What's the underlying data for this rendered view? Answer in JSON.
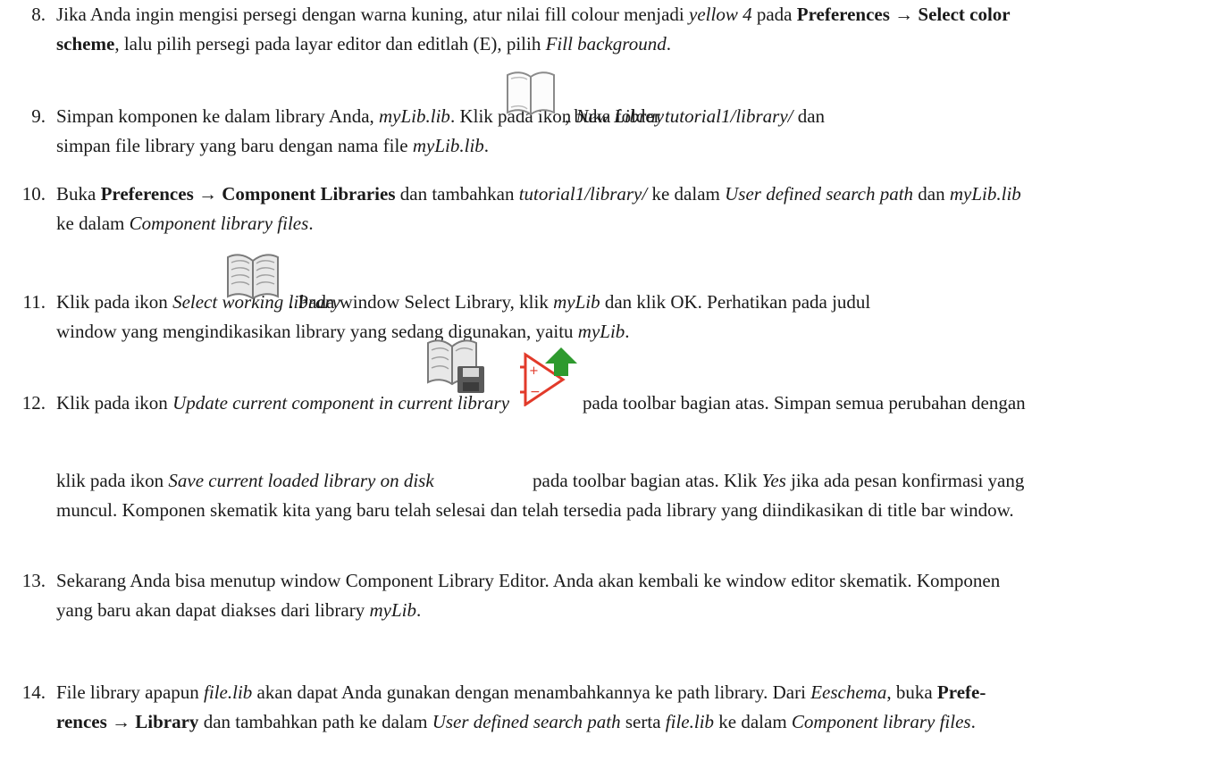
{
  "items": [
    {
      "num": "8.",
      "l1": {
        "a": "Jika Anda ingin mengisi persegi dengan warna kuning, atur nilai fill colour menjadi ",
        "b": "yellow 4",
        "c": " pada ",
        "d": "Preferences",
        "e": " → ",
        "f": "Select color"
      },
      "l2": {
        "a": "scheme",
        "b": ", lalu pilih persegi pada layar editor dan editlah (E), pilih ",
        "c": "Fill background",
        "d": "."
      }
    },
    {
      "num": "9.",
      "l1": {
        "a": "Simpan komponen ke dalam library Anda, ",
        "b": "myLib.lib",
        "c": ". Klik pada ikon ",
        "d": "New Libray",
        "e": ", buka folder ",
        "f": "tutorial1/library/",
        "g": " dan"
      },
      "l2": {
        "a": "simpan file library yang baru dengan nama file ",
        "b": "myLib.lib",
        "c": "."
      }
    },
    {
      "num": "10.",
      "l1": {
        "a": "Buka ",
        "b": "Preferences",
        "c": " → ",
        "d": "Component Libraries",
        "e": " dan tambahkan ",
        "f": "tutorial1/library/",
        "g": " ke dalam ",
        "h": "User defined search path",
        "i": " dan ",
        "j": "myLib.lib"
      },
      "l2": {
        "a": "ke dalam ",
        "b": "Component library files",
        "c": "."
      }
    },
    {
      "num": "11.",
      "l1": {
        "a": "Klik pada ikon ",
        "b": "Select working library",
        "c": ". Pada window Select Library, klik ",
        "d": "myLib",
        "e": " dan klik OK. Perhatikan pada judul"
      },
      "l2": {
        "a": "window yang mengindikasikan library yang sedang digunakan, yaitu ",
        "b": "myLib",
        "c": "."
      }
    },
    {
      "num": "12.",
      "l1": {
        "a": "Klik pada ikon ",
        "b": "Update current component in current library",
        "c": "pada toolbar bagian atas. Simpan semua perubahan dengan"
      },
      "l2": {
        "a": "klik pada ikon ",
        "b": "Save current loaded library on disk",
        "c": "pada toolbar bagian atas. Klik ",
        "d": "Yes",
        "e": " jika ada pesan konfirmasi yang"
      },
      "l3": {
        "a": "muncul. Komponen skematik kita yang baru telah selesai dan telah tersedia pada library yang diindikasikan di title bar window."
      }
    },
    {
      "num": "13.",
      "l1": {
        "a": "Sekarang Anda bisa menutup window Component Library Editor. Anda akan kembali ke window editor skematik. Komponen"
      },
      "l2": {
        "a": "yang baru akan dapat diakses dari library ",
        "b": "myLib",
        "c": "."
      }
    },
    {
      "num": "14.",
      "l1": {
        "a": "File library apapun ",
        "b": "file.lib",
        "c": " akan dapat Anda gunakan dengan menambahkannya ke path library. Dari ",
        "d": "Eeschema",
        "e": ", buka ",
        "f": "Prefe-"
      },
      "l2": {
        "a": "rences",
        "b": " → ",
        "c": "Library",
        "d": " dan tambahkan path ke dalam ",
        "e": "User defined search path",
        "f": " serta ",
        "g": "file.lib",
        "h": " ke dalam ",
        "i": "Component library files",
        "j": "."
      }
    }
  ],
  "icons": {
    "new_library": "book-outline-icon",
    "select_working_library": "book-open-icon",
    "update_component": "component-arrow-up-icon",
    "save_library": "book-disk-icon",
    "colors": {
      "green": "#2e9a2e",
      "red": "#e23a2a",
      "gray": "#8a8a8a"
    }
  }
}
